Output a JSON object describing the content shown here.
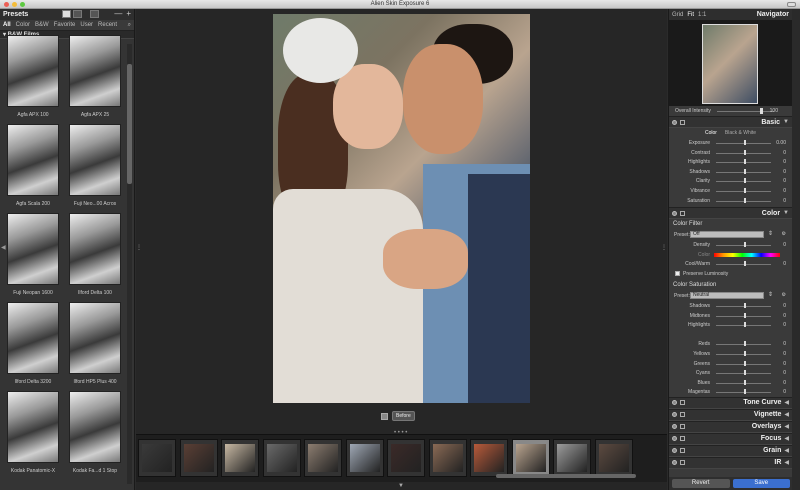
{
  "window": {
    "title": "Alien Skin Exposure 6"
  },
  "presets_panel": {
    "title": "Presets",
    "controls": {
      "minus": "—",
      "plus": "+"
    },
    "tabs": [
      "All",
      "Color",
      "B&W",
      "Favorite",
      "User",
      "Recent"
    ],
    "active_tab": "All",
    "category": "▾ B&W Films",
    "items": [
      "Agfa APX 100",
      "Agfa APX 25",
      "Agfa Scala 200",
      "Fuji Neo...00 Acros",
      "Fuji Neopan 1600",
      "Ilford Delta 100",
      "Ilford Delta 3200",
      "Ilford HP5 Plus 400",
      "Kodak Panatomic-X",
      "Kodak Fa...d 1 Stop"
    ]
  },
  "compare": {
    "before_label": "Before"
  },
  "filmstrip": {
    "count": 12,
    "selected_index": 9
  },
  "right_panel": {
    "nav_tabs": [
      "Grid",
      "Fit",
      "1:1"
    ],
    "active_nav_tab": "Fit",
    "title": "Navigator",
    "overall_intensity": {
      "label": "Overall Intensity",
      "value": "100",
      "level": 1.0
    },
    "sections": {
      "basic": {
        "title": "Basic",
        "tabs": [
          "Color",
          "Black & White"
        ],
        "active_tab": "Color",
        "sliders": [
          {
            "label": "Exposure",
            "value": "0.00",
            "level": 0.5
          },
          {
            "label": "Contrast",
            "value": "0",
            "level": 0.5
          },
          {
            "label": "Highlights",
            "value": "0",
            "level": 0.5
          },
          {
            "label": "Shadows",
            "value": "0",
            "level": 0.5
          },
          {
            "label": "Clarity",
            "value": "0",
            "level": 0.5
          },
          {
            "label": "Vibrance",
            "value": "0",
            "level": 0.5
          },
          {
            "label": "Saturation",
            "value": "0",
            "level": 0.5
          }
        ]
      },
      "color": {
        "title": "Color",
        "filter": {
          "heading": "Color Filter",
          "preset_label": "Preset:",
          "preset_value": "Off",
          "density": {
            "label": "Density",
            "value": "0",
            "level": 0.5
          },
          "color_label": "Color",
          "coolwarm": {
            "label": "Cool/Warm",
            "value": "0",
            "level": 0.5
          },
          "preserve": "Preserve Luminosity"
        },
        "saturation": {
          "heading": "Color Saturation",
          "preset_label": "Preset:",
          "preset_value": "Neutral",
          "sliders": [
            {
              "label": "Shadows",
              "value": "0",
              "level": 0.5
            },
            {
              "label": "Midtones",
              "value": "0",
              "level": 0.5
            },
            {
              "label": "Highlights",
              "value": "0",
              "level": 0.5
            },
            {
              "label": "",
              "value": "",
              "level": null
            },
            {
              "label": "Reds",
              "value": "0",
              "level": 0.5
            },
            {
              "label": "Yellows",
              "value": "0",
              "level": 0.5
            },
            {
              "label": "Greens",
              "value": "0",
              "level": 0.5
            },
            {
              "label": "Cyans",
              "value": "0",
              "level": 0.5
            },
            {
              "label": "Blues",
              "value": "0",
              "level": 0.5
            },
            {
              "label": "Magentas",
              "value": "0",
              "level": 0.5
            }
          ]
        }
      },
      "collapsed": [
        "Tone Curve",
        "Vignette",
        "Overlays",
        "Focus",
        "Grain",
        "IR"
      ]
    },
    "buttons": {
      "revert": "Revert",
      "save": "Save"
    }
  },
  "colors": {
    "accent": "#3b6fcf",
    "panel": "#3a3a3a",
    "canvas": "#262626"
  },
  "icons": [
    "grid-view-icon",
    "filmstrip-view-icon",
    "detail-view-icon",
    "search-icon",
    "chevron-down-icon",
    "before-after-icon"
  ]
}
